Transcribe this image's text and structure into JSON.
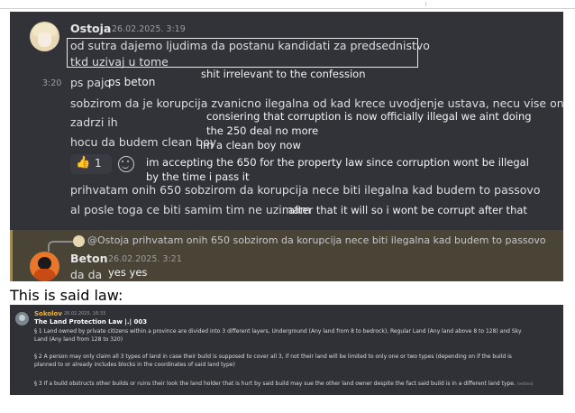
{
  "chat": {
    "msg1": {
      "author": "Ostoja",
      "timestamp": "26.02.2025. 3:19",
      "lines": [
        "od sutra dajemo ljudima da postanu kandidati za predsednistvo",
        "tkd uzivaj u tome"
      ]
    },
    "annotations": {
      "a1": "shit irrelevant to the confession",
      "a2": "ps beton",
      "a3_line1": "consiering that corruption is now officially illegal we aint doing",
      "a3_line2": "the 250 deal no more",
      "a4": "im a clean boy now",
      "a5_line1": "im accepting the 650 for the property law since corruption wont be illegal",
      "a5_line2": "by the time i pass it",
      "a6": "after that it will so i wont be corrupt after that",
      "a7": "yes yes"
    },
    "side_time": "3:20",
    "lines": {
      "l1": "ps pajo",
      "l2": "sobzirom da je korupcija zvanicno ilegalna od kad krece uvodjenje ustava, necu vise onih 250",
      "l3": "zadrzi ih",
      "l4": "hocu da budem clean boy",
      "l5": "prihvatam onih 650 sobzirom da korupcija nece biti ilegalna kad budem to passovo",
      "l6": "al posle toga ce biti samim tim ne uzimam"
    },
    "reaction": {
      "icon": "thumbs-up-icon",
      "count": "1"
    },
    "reply_preview": "@Ostoja prihvatam onih 650 sobzirom da korupcija nece biti ilegalna kad budem to passovo",
    "msg2": {
      "author": "Beton",
      "timestamp": "26.02.2025. 3:21",
      "text": "da da"
    }
  },
  "caption": "This is said law:",
  "law": {
    "author": "Sokolov",
    "timestamp": "26.02.2025. 16:33",
    "title": "The Land Protection Law |.| 003",
    "p1a": "§ 1 Land owned by private citizens within a province are divided into 3 different layers, Underground  (Any land from 8 to bedrock), Regular Land (Any land above 8 to 128) and Sky",
    "p1b": "Land (Any land from 128 to 320)",
    "p2a": "§ 2 A person may only claim all 3 types of land in case their build is supposed to cover all 3, if not their land will be limited to only one or two types (depending on if the build is",
    "p2b": "planned to or already includes blocks in the coordinates of said land type)",
    "p3": "§ 3 If a build obstructs other builds or ruins their look the land holder that is hurt by said build may sue the other land owner despite the fact said build is in a different land type.",
    "edited": "(edited)"
  }
}
